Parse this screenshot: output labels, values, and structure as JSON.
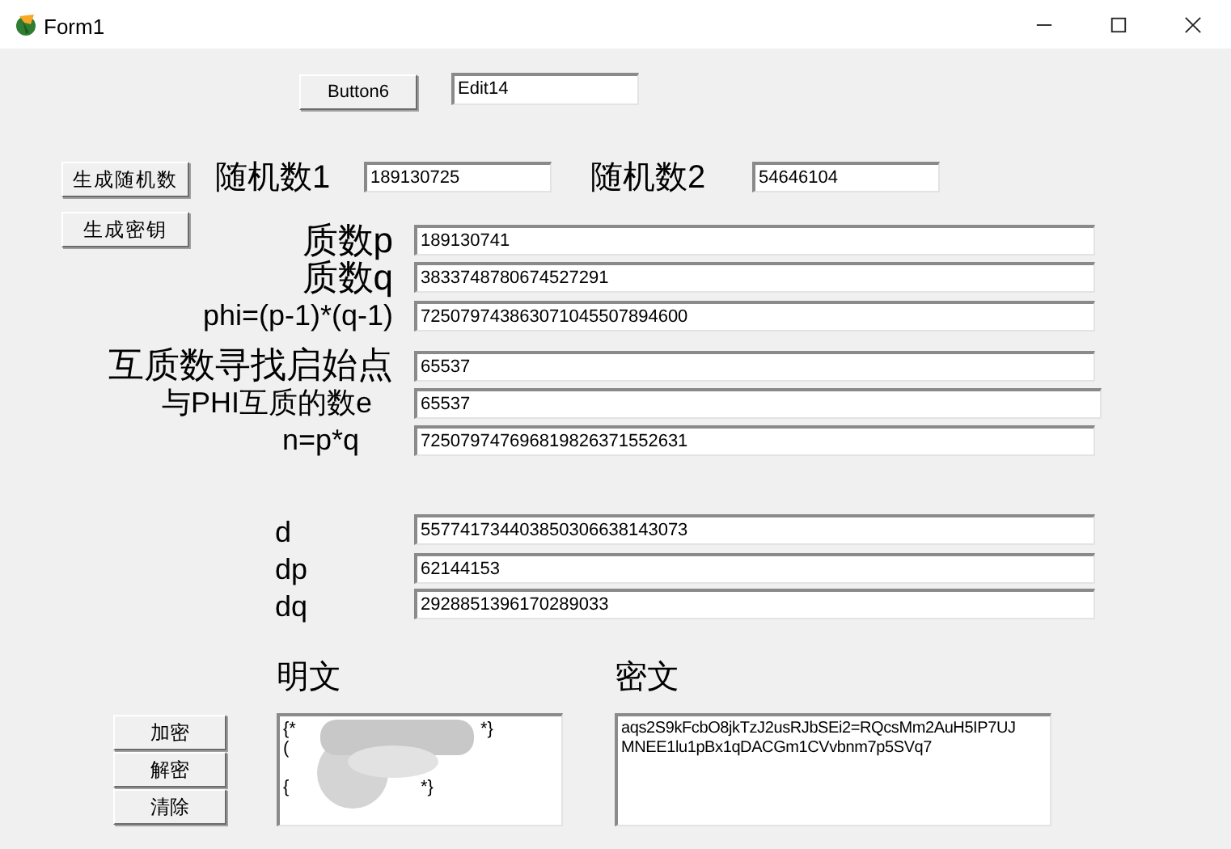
{
  "window": {
    "title": "Form1"
  },
  "top_button": "Button6",
  "top_edit": "Edit14",
  "side_buttons": [
    "生成随机数",
    "生成密钥"
  ],
  "random": [
    {
      "label": "随机数1",
      "value": "189130725"
    },
    {
      "label": "随机数2",
      "value": "54646104"
    }
  ],
  "key_fields": [
    {
      "label": "质数p",
      "value": "189130741"
    },
    {
      "label": "质数q",
      "value": "3833748780674527291"
    },
    {
      "label": "phi=(p-1)*(q-1)",
      "value": "725079743863071045507894600"
    },
    {
      "label": "互质数寻找启始点",
      "value": "65537"
    },
    {
      "label": "与PHI互质的数e",
      "value": "65537"
    },
    {
      "label": "n=p*q",
      "value": "725079747696819826371552631"
    },
    {
      "label": "d",
      "value": "557741734403850306638143073"
    },
    {
      "label": "dp",
      "value": "62144153"
    },
    {
      "label": "dq",
      "value": "2928851396170289033"
    }
  ],
  "plaintext": {
    "label": "明文",
    "lines": [
      [
        "{*",
        "*}"
      ],
      [
        "("
      ],
      [
        "{",
        "*}"
      ]
    ]
  },
  "ciphertext": {
    "label": "密文",
    "lines": [
      "aqs2S9kFcbO8jkTzJ2usRJbSEi2=RQcsMm2AuH5IP7UJ",
      "MNEE1lu1pBx1qDACGm1CVvbnm7p5SVq7"
    ]
  },
  "action_buttons": [
    "加密",
    "解密",
    "清除"
  ]
}
